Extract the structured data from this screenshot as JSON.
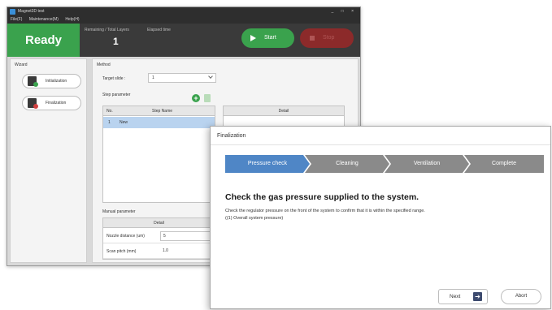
{
  "window": {
    "title": "Magnet3D  test",
    "controls": "_ □ ×"
  },
  "menu": {
    "items": [
      "File(F)",
      "Maintenance(M)",
      "Help(H)"
    ]
  },
  "status": {
    "state": "Ready",
    "layers_label": "Remaining / Total Layers",
    "layers_value": "1",
    "elapsed_label": "Elapsed time",
    "start_label": "Start",
    "stop_label": "Stop"
  },
  "wizard": {
    "title": "Wizard",
    "initialization_label": "Initialization",
    "finalization_label": "Finalization"
  },
  "method": {
    "title": "Method",
    "target_slide_label": "Target slide :",
    "target_slide_value": "1",
    "step_parameter_label": "Step parameter",
    "step_table": {
      "headers": [
        "No.",
        "Step Name"
      ],
      "rows": [
        {
          "no": "1",
          "name": "New"
        }
      ]
    },
    "detail_header": "Detail",
    "manual_parameter_label": "Manual parameter",
    "manual_detail_header": "Detail",
    "manual_rows": [
      {
        "key": "Nozzle distance (um)",
        "value": "5"
      },
      {
        "key": "Scan pitch (mm)",
        "value": "1.0"
      }
    ]
  },
  "dialog": {
    "title": "Finalization",
    "steps": [
      "Pressure check",
      "Cleaning",
      "Ventilation",
      "Complete"
    ],
    "active_step": 0,
    "heading": "Check the gas pressure supplied to the system.",
    "instruction": "Check the regulator pressure on the front of the system to confirm that it is within the specified range.",
    "subitem": "((1) Overall system pressure)",
    "next_label": "Next",
    "abort_label": "Abort"
  },
  "colors": {
    "ready_green": "#3aa24d",
    "stop_red": "#8c2a2a",
    "step_active": "#4f86c6",
    "step_inactive": "#8a8a8a",
    "selected_row": "#b9d3ef"
  },
  "icons": [
    "play-icon",
    "stop-icon",
    "add-icon",
    "delete-icon",
    "arrow-right-icon",
    "chevron-down-icon"
  ]
}
